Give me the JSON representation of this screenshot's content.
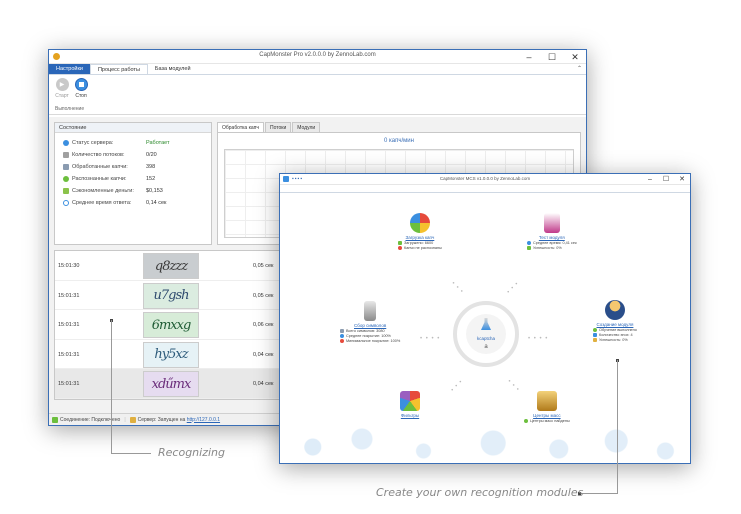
{
  "window1": {
    "title": "CapMonster Pro v2.0.0.0 by ZennoLab.com",
    "tabs": [
      "Настройки",
      "Процесс работы",
      "База модулей"
    ],
    "active_tab": "Процесс работы",
    "ribbon": {
      "start": "Старт",
      "stop": "Стоп",
      "group": "Выполнение"
    },
    "state": {
      "title": "Состояние",
      "rows": [
        {
          "label": "Статус сервера:",
          "value": "Работает"
        },
        {
          "label": "Количество потоков:",
          "value": "0/20"
        },
        {
          "label": "Обработанные капчи:",
          "value": "398"
        },
        {
          "label": "Распознанные капчи:",
          "value": "152"
        },
        {
          "label": "Сэкономленные деньги:",
          "value": "$0,153"
        },
        {
          "label": "Среднее время ответа:",
          "value": "0,14 сек"
        }
      ]
    },
    "process_tabs": [
      "Обработка капч",
      "Потоки",
      "Модули"
    ],
    "rate": "0 капч/мин",
    "log": [
      {
        "time": "15:01:30",
        "captcha": "q8zzz",
        "duration": "0,05 сек"
      },
      {
        "time": "15:01:31",
        "captcha": "u7gsh",
        "duration": "0,05 сек"
      },
      {
        "time": "15:01:31",
        "captcha": "6mxxg",
        "duration": "0,06 сек"
      },
      {
        "time": "15:01:31",
        "captcha": "hy5xz",
        "duration": "0,04 сек"
      },
      {
        "time": "15:01:31",
        "captcha": "xdűmx",
        "duration": "0,04 сек"
      }
    ],
    "status": {
      "connection": "Соединение: Подключено",
      "server": "Сервер: Запущен на",
      "server_link": "http://127.0.0.1"
    }
  },
  "window2": {
    "title": "CapMonster MCS v1.0.0.0 by ZennoLab.com",
    "tab": "Проект",
    "center": "kcaptcha",
    "nodes": {
      "load": {
        "title": "Загрузка капч",
        "lines": [
          "Загружено: 6600",
          "Капчи не распознаны"
        ]
      },
      "test": {
        "title": "Тест модуля",
        "lines": [
          "Среднее время: 0,41 сек",
          "Успешность: 0%"
        ]
      },
      "collect": {
        "title": "Сбор символов",
        "lines": [
          "Всего символов: 3080",
          "Среднее покрытие: 100%",
          "Минимальное покрытие: 100%"
        ]
      },
      "create": {
        "title": "Создание модуля",
        "lines": [
          "Обучение выполнено",
          "Количество эпох: 4",
          "Успешность: 0%"
        ]
      },
      "filters": {
        "title": "Фильтры"
      },
      "centers": {
        "title": "Центры масс",
        "lines": [
          "Центры масс найдены"
        ]
      }
    }
  },
  "annotations": {
    "recognizing": "Recognizing",
    "create_modules": "Create your own recognition modules"
  }
}
